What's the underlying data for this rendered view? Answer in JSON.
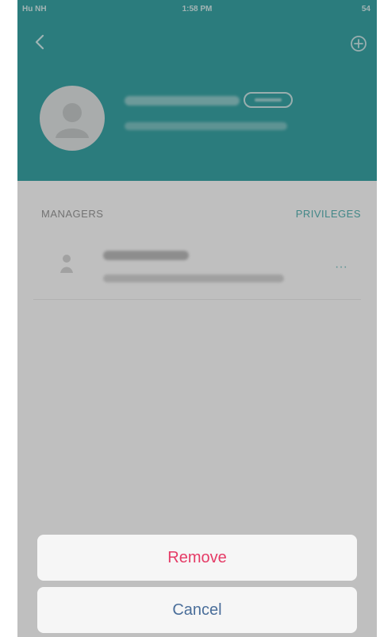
{
  "status": {
    "carrier": "Hu NH",
    "time": "1:58 PM",
    "battery": "54"
  },
  "section": {
    "managers_label": "MANAGERS",
    "privileges_label": "PRIVILEGES"
  },
  "action_sheet": {
    "remove_label": "Remove",
    "cancel_label": "Cancel"
  },
  "row": {
    "more_label": "···"
  },
  "colors": {
    "header": "#3aa6a7",
    "accent": "#58b4b5",
    "destructive": "#e53b66",
    "cancel": "#4a6e9a"
  },
  "icons": [
    "back-icon",
    "add-manager-icon",
    "avatar-icon",
    "manager-icon",
    "more-icon"
  ]
}
